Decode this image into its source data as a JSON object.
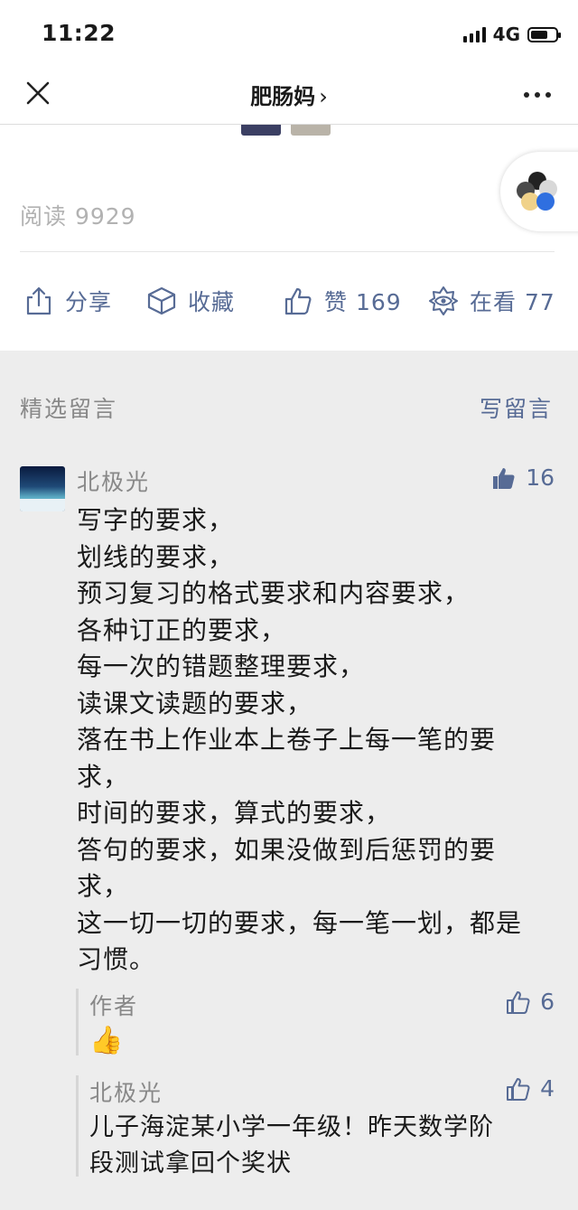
{
  "status_bar": {
    "time": "11:22",
    "network": "4G"
  },
  "nav": {
    "title": "肥肠妈",
    "chevron": "›"
  },
  "article": {
    "read_count": "阅读 9929",
    "actions": {
      "share": "分享",
      "favorite": "收藏",
      "like": "赞 169",
      "wow": "在看 77"
    }
  },
  "comments": {
    "header": "精选留言",
    "write": "写留言",
    "items": [
      {
        "author": "北极光",
        "likes": "16",
        "lines": [
          "写字的要求，",
          "划线的要求，",
          "预习复习的格式要求和内容要求，",
          "各种订正的要求，",
          "每一次的错题整理要求，",
          "读课文读题的要求，",
          "落在书上作业本上卷子上每一笔的要",
          "求，",
          "时间的要求，算式的要求，",
          "答句的要求，如果没做到后惩罚的要",
          "求，",
          "这一切一切的要求，每一笔一划，都是",
          "习惯。"
        ],
        "replies": [
          {
            "author": "作者",
            "likes": "6",
            "text": "👍"
          },
          {
            "author": "北极光",
            "likes": "4",
            "lines": [
              "儿子海淀某小学一年级！昨天数学阶",
              "段测试拿回个奖状"
            ]
          }
        ]
      }
    ]
  },
  "colors": {
    "link": "#576b95",
    "muted": "#888888",
    "background": "#ededed"
  },
  "icons": [
    "close-icon",
    "more-icon",
    "share-icon",
    "favorite-icon",
    "thumb-up-icon",
    "wow-icon"
  ]
}
